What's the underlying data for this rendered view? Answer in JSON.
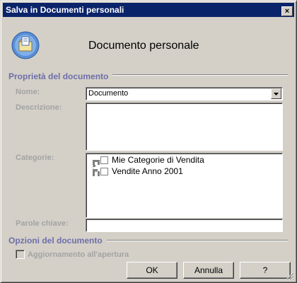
{
  "window": {
    "title": "Salva in Documenti personali",
    "close_label": "×",
    "icon": "folder-document-icon"
  },
  "header": {
    "title": "Documento personale"
  },
  "properties": {
    "section_title": "Proprietà del documento",
    "name": {
      "label": "Nome:",
      "value": "Documento"
    },
    "description": {
      "label": "Descrizione:",
      "value": ""
    },
    "categories": {
      "label": "Categorie:",
      "items": [
        {
          "label": "Mie Categorie di Vendita",
          "checked": false
        },
        {
          "label": "Vendite Anno 2001",
          "checked": false
        }
      ]
    },
    "keywords": {
      "label": "Parole chiave:",
      "value": ""
    }
  },
  "options": {
    "section_title": "Opzioni del documento",
    "update_on_open": {
      "label": "Aggiornamento all'apertura",
      "checked": false,
      "enabled": false
    }
  },
  "buttons": {
    "ok": "OK",
    "cancel": "Annulla",
    "help": "?"
  },
  "colors": {
    "titlebar": "#0a246a",
    "section_title": "#6e6ea8",
    "disabled_label": "#a3a3a3",
    "face": "#d4d0c8"
  }
}
